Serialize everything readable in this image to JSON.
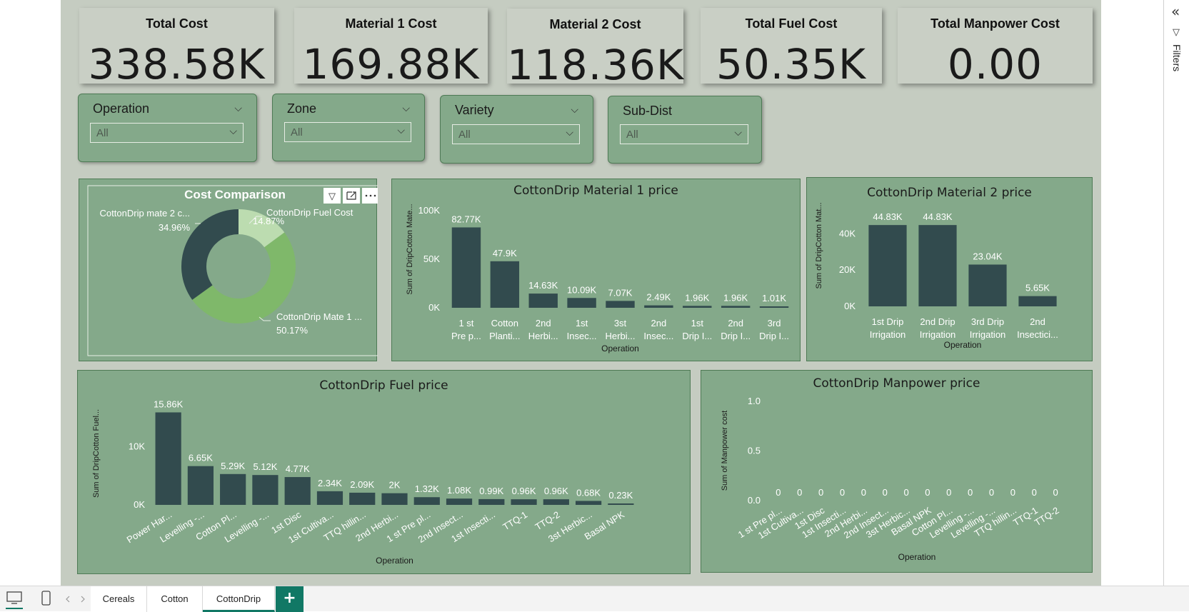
{
  "kpis": [
    {
      "title": "Total Cost",
      "value": "338.58K"
    },
    {
      "title": "Material 1 Cost",
      "value": "169.88K"
    },
    {
      "title": "Material 2 Cost",
      "value": "118.36K"
    },
    {
      "title": "Total Fuel Cost",
      "value": "50.35K"
    },
    {
      "title": "Total Manpower Cost",
      "value": "0.00"
    }
  ],
  "slicers": [
    {
      "title": "Operation",
      "value": "All"
    },
    {
      "title": "Zone",
      "value": "All"
    },
    {
      "title": "Variety",
      "value": "All"
    },
    {
      "title": "Sub-Dist",
      "value": "All"
    }
  ],
  "filters_pane": {
    "label": "Filters",
    "collapse_glyph": "«",
    "filter_glyph": "▽"
  },
  "icons": {
    "filter": "filter-icon",
    "focus": "focus-mode-icon",
    "more": "more-options-icon",
    "chevron": "chevron-down-icon"
  },
  "colors": {
    "bar": "#324b4e",
    "panel": "#84a98a",
    "donut_dark": "#324b4e",
    "donut_mid": "#7fb86a",
    "donut_light": "#bcdcb0",
    "accent": "#117865"
  },
  "tabs": {
    "items": [
      "Cereals",
      "Cotton",
      "CottonDrip"
    ],
    "active": "CottonDrip",
    "add_label": "+"
  },
  "chart_data": [
    {
      "type": "pie",
      "title": "Cost Comparison",
      "slices": [
        {
          "label": "CottonDrip Fuel Cost",
          "value": 14.87,
          "pct": "14.87%"
        },
        {
          "label": "CottonDrip Mate 1 ...",
          "value": 50.17,
          "pct": "50.17%"
        },
        {
          "label": "CottonDrip mate 2 c...",
          "value": 34.96,
          "pct": "34.96%"
        }
      ]
    },
    {
      "type": "bar",
      "title": "CottonDrip Material 1 price",
      "xlabel": "Operation",
      "ylabel": "Sum of DripCotton Mate...",
      "ylim": [
        0,
        100000
      ],
      "yticks": [
        "0K",
        "50K",
        "100K"
      ],
      "categories": [
        "1 st|Pre p...",
        "Cotton|Planti...",
        "2nd|Herbi...",
        "1st|Insec...",
        "3st|Herbi...",
        "2nd|Insec...",
        "1st|Drip I...",
        "2nd|Drip I...",
        "3rd|Drip I..."
      ],
      "values": [
        82770,
        47900,
        14630,
        10090,
        7070,
        2490,
        1960,
        1960,
        1010
      ],
      "labels": [
        "82.77K",
        "47.9K",
        "14.63K",
        "10.09K",
        "7.07K",
        "2.49K",
        "1.96K",
        "1.96K",
        "1.01K"
      ]
    },
    {
      "type": "bar",
      "title": "CottonDrip Material 2 price",
      "xlabel": "Operation",
      "ylabel": "Sum of DripCotton Mat...",
      "ylim": [
        0,
        50000
      ],
      "yticks": [
        "0K",
        "20K",
        "40K"
      ],
      "categories": [
        "1st Drip|Irrigation",
        "2nd Drip|Irrigation",
        "3rd Drip|Irrigation",
        "2nd|Insectici..."
      ],
      "values": [
        44830,
        44830,
        23040,
        5650
      ],
      "labels": [
        "44.83K",
        "44.83K",
        "23.04K",
        "5.65K"
      ]
    },
    {
      "type": "bar",
      "title": "CottonDrip Fuel price",
      "xlabel": "Operation",
      "ylabel": "Sum of DripCotton Fuel...",
      "ylim": [
        0,
        18000
      ],
      "yticks": [
        "0K",
        "10K"
      ],
      "categories": [
        "Power Har...",
        "Levelling -...",
        "Cotton Pl...",
        "Levelling -...",
        "1st Disc",
        "1st Cultiva...",
        "TTQ hillin...",
        "2nd Herbi...",
        "1 st Pre pl...",
        "2nd Insect...",
        "1st Insecti...",
        "TTQ-1",
        "TTQ-2",
        "3st Herbic...",
        "Basal NPK"
      ],
      "values": [
        15860,
        6650,
        5290,
        5120,
        4770,
        2340,
        2090,
        2000,
        1320,
        1080,
        990,
        960,
        960,
        680,
        230
      ],
      "labels": [
        "15.86K",
        "6.65K",
        "5.29K",
        "5.12K",
        "4.77K",
        "2.34K",
        "2.09K",
        "2K",
        "1.32K",
        "1.08K",
        "0.99K",
        "0.96K",
        "0.96K",
        "0.68K",
        "0.23K"
      ]
    },
    {
      "type": "bar",
      "title": "CottonDrip Manpower price",
      "xlabel": "Operation",
      "ylabel": "Sum of Manpower cost",
      "ylim": [
        0,
        1
      ],
      "yticks": [
        "0.0",
        "0.5",
        "1.0"
      ],
      "categories": [
        "1 st Pre pl...",
        "1st Cultiva...",
        "1st Disc",
        "1st Insecti...",
        "2nd Herbi...",
        "2nd Insect...",
        "3st Herbic...",
        "Basal NPK",
        "Cotton Pl...",
        "Levelling -...",
        "Levelling -...",
        "TTQ hillin...",
        "TTQ-1",
        "TTQ-2"
      ],
      "values": [
        0,
        0,
        0,
        0,
        0,
        0,
        0,
        0,
        0,
        0,
        0,
        0,
        0,
        0
      ],
      "labels": [
        "0",
        "0",
        "0",
        "0",
        "0",
        "0",
        "0",
        "0",
        "0",
        "0",
        "0",
        "0",
        "0",
        "0"
      ]
    }
  ]
}
